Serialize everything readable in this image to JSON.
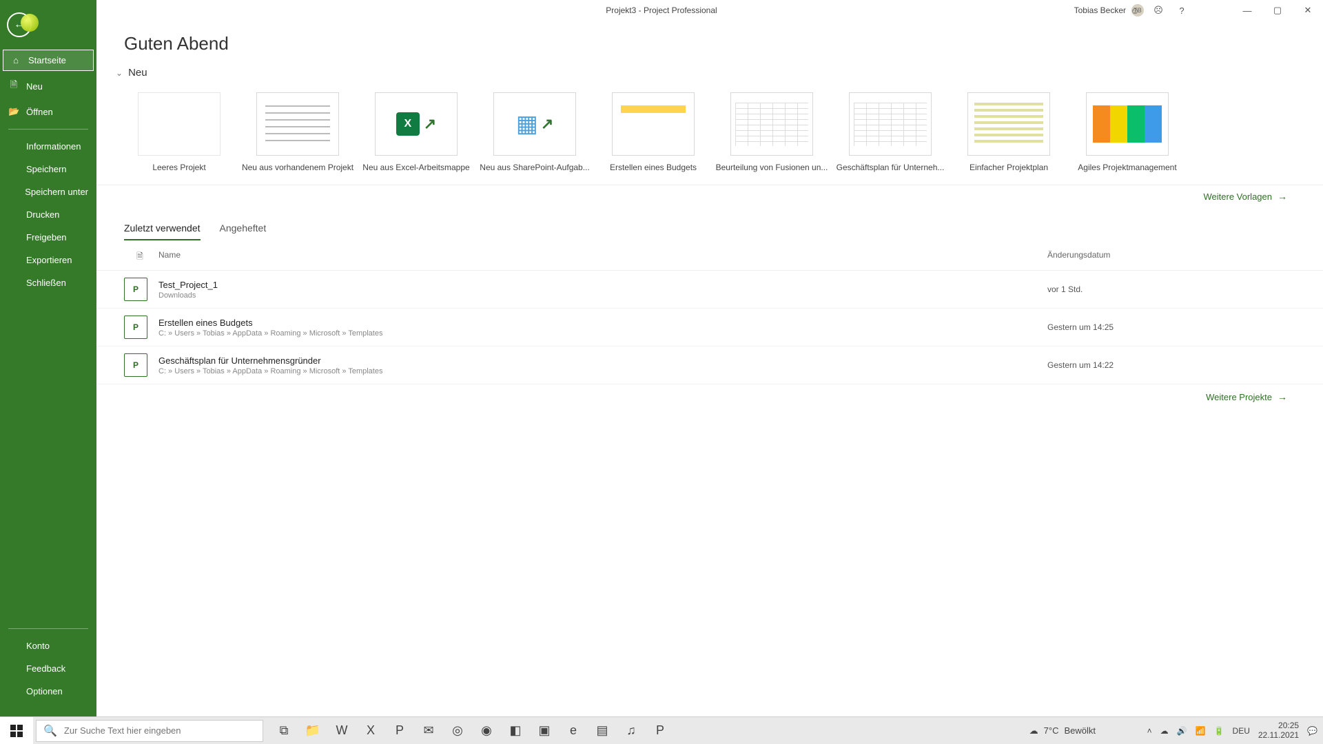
{
  "window": {
    "title": "Projekt3  -  Project Professional",
    "user_name": "Tobias Becker",
    "user_initials": "TB"
  },
  "sidebar": {
    "back_tooltip": "Zurück",
    "items_upper": [
      {
        "icon": "⌂",
        "label": "Startseite",
        "selected": true
      },
      {
        "icon": "🗎",
        "label": "Neu",
        "selected": false
      },
      {
        "icon": "📂",
        "label": "Öffnen",
        "selected": false
      }
    ],
    "items_mid": [
      {
        "label": "Informationen"
      },
      {
        "label": "Speichern"
      },
      {
        "label": "Speichern unter"
      },
      {
        "label": "Drucken"
      },
      {
        "label": "Freigeben"
      },
      {
        "label": "Exportieren"
      },
      {
        "label": "Schließen"
      }
    ],
    "items_bottom": [
      {
        "label": "Konto"
      },
      {
        "label": "Feedback"
      },
      {
        "label": "Optionen"
      }
    ]
  },
  "main": {
    "greeting": "Guten Abend",
    "new_section": "Neu",
    "templates": [
      {
        "label": "Leeres Projekt",
        "kind": "blank"
      },
      {
        "label": "Neu aus vorhandenem Projekt",
        "kind": "lines"
      },
      {
        "label": "Neu aus Excel-Arbeitsmappe",
        "kind": "excel"
      },
      {
        "label": "Neu aus SharePoint-Aufgab...",
        "kind": "sp"
      },
      {
        "label": "Erstellen eines Budgets",
        "kind": "budget"
      },
      {
        "label": "Beurteilung von Fusionen un...",
        "kind": "table"
      },
      {
        "label": "Geschäftsplan für Unterneh...",
        "kind": "table"
      },
      {
        "label": "Einfacher Projektplan",
        "kind": "list"
      },
      {
        "label": "Agiles Projektmanagement",
        "kind": "agile"
      }
    ],
    "more_templates": "Weitere Vorlagen",
    "tabs": {
      "recent": "Zuletzt verwendet",
      "pinned": "Angeheftet"
    },
    "columns": {
      "icon": "🗎",
      "name": "Name",
      "date": "Änderungsdatum"
    },
    "recents": [
      {
        "name": "Test_Project_1",
        "path": "Downloads",
        "date": "vor 1 Std."
      },
      {
        "name": "Erstellen eines Budgets",
        "path": "C: » Users » Tobias » AppData » Roaming » Microsoft » Templates",
        "date": "Gestern um 14:25"
      },
      {
        "name": "Geschäftsplan für Unternehmensgründer",
        "path": "C: » Users » Tobias » AppData » Roaming » Microsoft » Templates",
        "date": "Gestern um 14:22"
      }
    ],
    "more_projects": "Weitere Projekte"
  },
  "taskbar": {
    "search_placeholder": "Zur Suche Text hier eingeben",
    "weather_temp": "7°C",
    "weather_text": "Bewölkt",
    "lang": "DEU",
    "time": "20:25",
    "date": "22.11.2021"
  }
}
